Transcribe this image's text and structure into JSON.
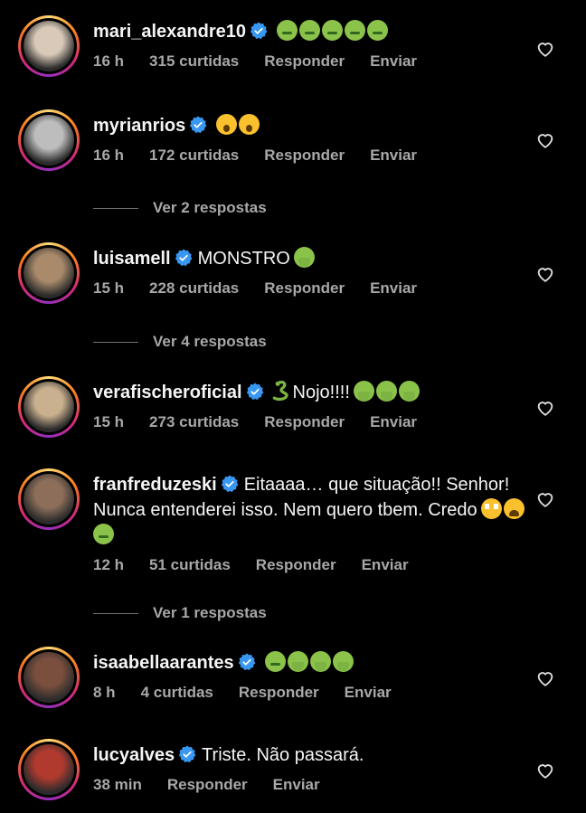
{
  "comments": [
    {
      "username": "mari_alexandre10",
      "text": "",
      "emojis": [
        "sick",
        "sick",
        "sick",
        "sick",
        "sick"
      ],
      "time": "16 h",
      "likes": "315 curtidas",
      "reply": "Responder",
      "send": "Enviar",
      "avatar_color": "#d9c9b8",
      "replies": ""
    },
    {
      "username": "myrianrios",
      "text": "",
      "emojis": [
        "wow",
        "wow"
      ],
      "time": "16 h",
      "likes": "172 curtidas",
      "reply": "Responder",
      "send": "Enviar",
      "avatar_color": "#bdbdbd",
      "replies": "Ver 2 respostas"
    },
    {
      "username": "luisamell",
      "text": "MONSTRO",
      "emojis": [
        "vomit"
      ],
      "time": "15 h",
      "likes": "228 curtidas",
      "reply": "Responder",
      "send": "Enviar",
      "avatar_color": "#a98a6a",
      "replies": "Ver 4 respostas"
    },
    {
      "username": "verafischeroficial",
      "text": "Nojo!!!!",
      "emojis": [
        "vomit",
        "vomit",
        "vomit"
      ],
      "time": "15 h",
      "likes": "273 curtidas",
      "reply": "Responder",
      "send": "Enviar",
      "avatar_color": "#c9b08e",
      "replies": ""
    },
    {
      "username": "franfreduzeski",
      "text": "Eitaaaa… que situação!! Senhor! Nunca entenderei isso.  Nem quero tbem. Credo",
      "emojis": [
        "flushed",
        "weary",
        "sick"
      ],
      "time": "12 h",
      "likes": "51 curtidas",
      "reply": "Responder",
      "send": "Enviar",
      "avatar_color": "#8d6e5a",
      "replies": "Ver 1 respostas"
    },
    {
      "username": "isaabellaarantes",
      "text": "",
      "emojis": [
        "sick",
        "vomit",
        "vomit",
        "vomit"
      ],
      "time": "8 h",
      "likes": "4 curtidas",
      "reply": "Responder",
      "send": "Enviar",
      "avatar_color": "#7a4f3e",
      "replies": ""
    },
    {
      "username": "lucyalves",
      "text": "Triste. Não passará.",
      "emojis": [],
      "time": "38 min",
      "likes": "",
      "reply": "Responder",
      "send": "Enviar",
      "avatar_color": "#b03a2e",
      "replies": ""
    }
  ],
  "colors": {
    "verified": "#3897f0",
    "meta": "#a8a8a8",
    "background": "#000000"
  },
  "icons": {
    "like": "heart-outline-icon",
    "verified": "verified-badge-icon"
  }
}
